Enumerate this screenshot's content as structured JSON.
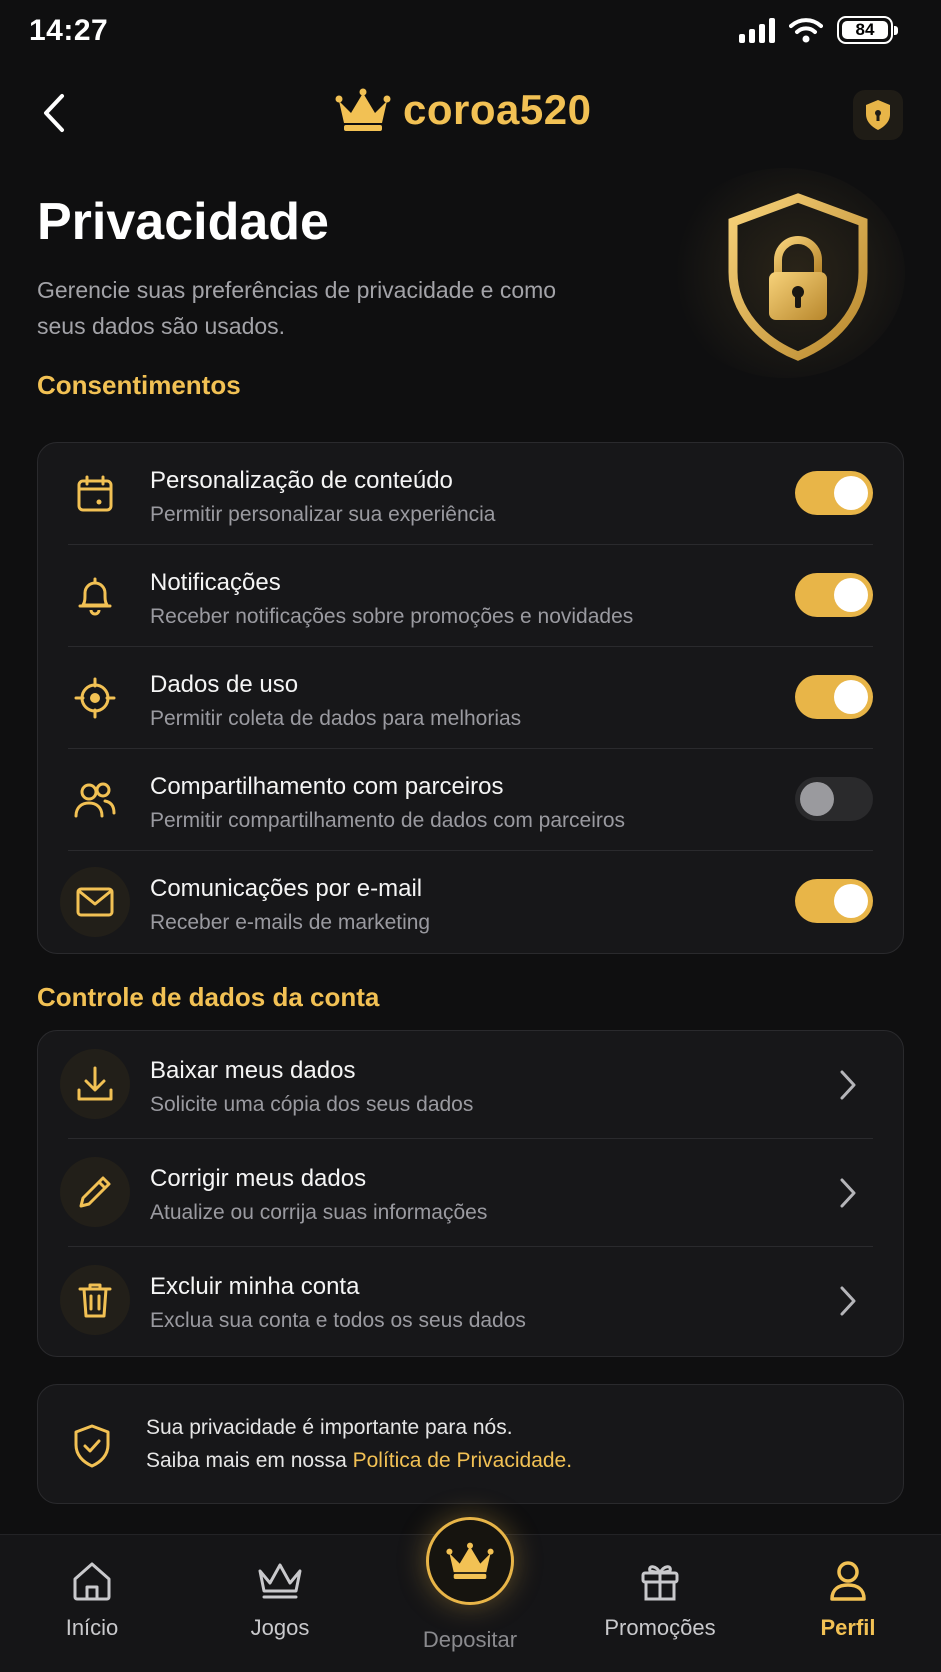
{
  "status_bar": {
    "time": "14:27",
    "battery": "84"
  },
  "header": {
    "brand": "coroa520"
  },
  "page": {
    "title": "Privacidade",
    "subtitle": "Gerencie suas preferências de privacidade e como seus dados são usados."
  },
  "consents": {
    "title": "Consentimentos",
    "items": [
      {
        "label": "Personalização de conteúdo",
        "desc": "Permitir personalizar sua experiência",
        "enabled": true,
        "icon": "calendar-icon"
      },
      {
        "label": "Notificações",
        "desc": "Receber notificações sobre promoções e novidades",
        "enabled": true,
        "icon": "bell-icon"
      },
      {
        "label": "Dados de uso",
        "desc": "Permitir coleta de dados para melhorias",
        "enabled": true,
        "icon": "target-icon"
      },
      {
        "label": "Compartilhamento com parceiros",
        "desc": "Permitir compartilhamento de dados com parceiros",
        "enabled": false,
        "icon": "users-icon"
      },
      {
        "label": "Comunicações por e-mail",
        "desc": "Receber e-mails de marketing",
        "enabled": true,
        "icon": "mail-icon"
      }
    ]
  },
  "account_data": {
    "title": "Controle de dados da conta",
    "items": [
      {
        "label": "Baixar meus dados",
        "desc": "Solicite uma cópia dos seus dados",
        "icon": "download-icon"
      },
      {
        "label": "Corrigir meus dados",
        "desc": "Atualize ou corrija suas informações",
        "icon": "pencil-icon"
      },
      {
        "label": "Excluir minha conta",
        "desc": "Exclua sua conta e todos os seus dados",
        "icon": "trash-icon"
      }
    ]
  },
  "info": {
    "line1": "Sua privacidade é importante para nós.",
    "line2_prefix": "Saiba mais em nossa ",
    "link": "Política de Privacidade."
  },
  "nav": {
    "home": "Início",
    "games": "Jogos",
    "deposit": "Depositar",
    "promotions": "Promoções",
    "profile": "Perfil",
    "active": "profile"
  },
  "colors": {
    "accent": "#f2c154",
    "toggle_on": "#e8b548",
    "background": "#0f0f10",
    "card": "#171719"
  }
}
